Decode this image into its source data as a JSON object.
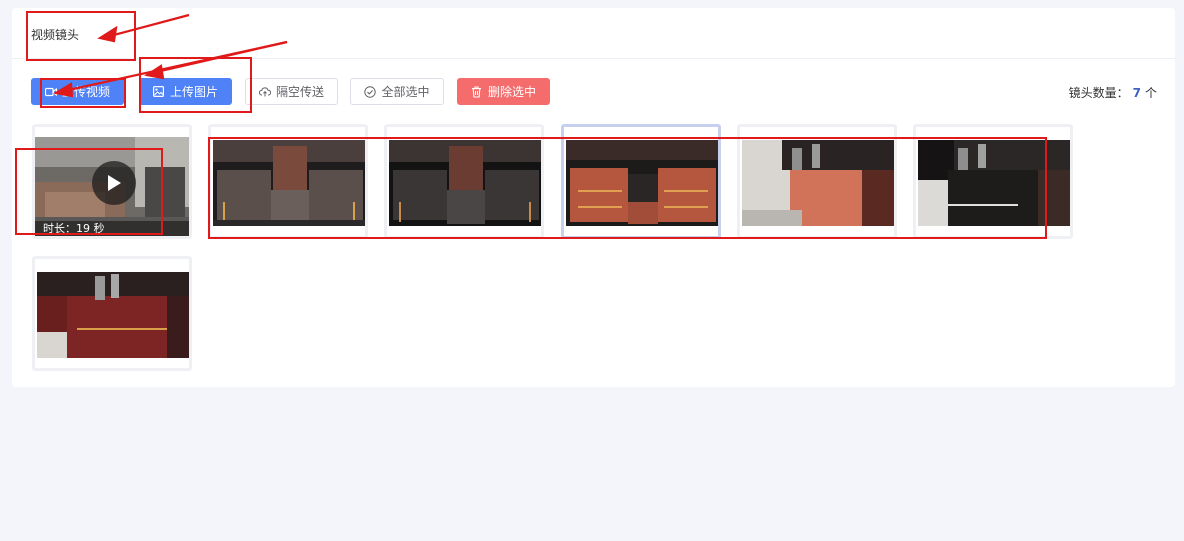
{
  "section": {
    "title": "视频镜头"
  },
  "toolbar": {
    "upload_video": "上传视频",
    "upload_image": "上传图片",
    "airdrop": "隔空传送",
    "select_all": "全部选中",
    "delete_selected": "删除选中"
  },
  "shot_count": {
    "label": "镜头数量：",
    "value": "7",
    "unit": "个"
  },
  "shots": [
    {
      "type": "video",
      "duration_label": "时长：19 秒"
    },
    {
      "type": "image"
    },
    {
      "type": "image"
    },
    {
      "type": "image",
      "selected": true
    },
    {
      "type": "image"
    },
    {
      "type": "image"
    },
    {
      "type": "image"
    }
  ],
  "colors": {
    "primary": "#4f82f7",
    "danger": "#f56c6c",
    "annotation": "#e01a1a",
    "count": "#3d63c7"
  },
  "icons": [
    "video-icon",
    "image-icon",
    "cloud-upload-icon",
    "check-circle-icon",
    "trash-icon",
    "play-icon"
  ]
}
